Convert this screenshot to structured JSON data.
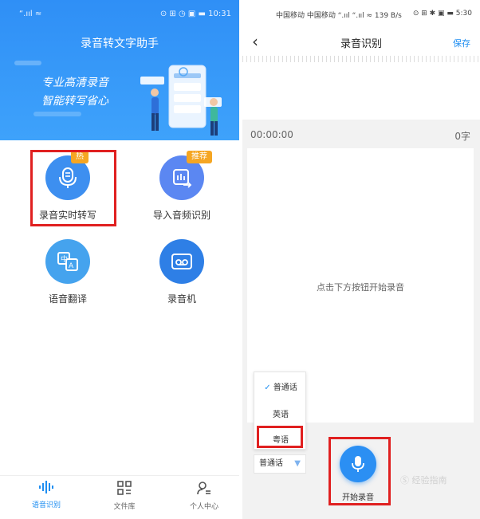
{
  "left": {
    "statusbar": {
      "signal": "“.ııl ≈",
      "right": "⊙ ⊞ ◷ ▣ ▬ 10:31"
    },
    "app_title": "录音转文字助手",
    "banner": {
      "line1": "专业高清录音",
      "line2": "智能转写省心"
    },
    "features": [
      {
        "label": "录音实时转写",
        "badge": "热",
        "icon": "mic-icon"
      },
      {
        "label": "导入音频识别",
        "badge": "推荐",
        "icon": "import-icon"
      },
      {
        "label": "语音翻译",
        "badge": "",
        "icon": "translate-icon"
      },
      {
        "label": "录音机",
        "badge": "",
        "icon": "recorder-icon"
      }
    ],
    "tabs": [
      {
        "label": "语音识别",
        "icon": "waveform-icon",
        "active": true
      },
      {
        "label": "文件库",
        "icon": "grid-icon",
        "active": false
      },
      {
        "label": "个人中心",
        "icon": "user-icon",
        "active": false
      }
    ],
    "colors": {
      "header": "#2f8ff6",
      "accent": "#1f8ef1",
      "badge": "#f5a623",
      "highlight": "#e02020"
    }
  },
  "right": {
    "statusbar": {
      "left": "中国移动 中国移动 “.ııl “.ııl ≈ 139 B/s",
      "right": "⊙ ⊞ ✱ ▣ ▬ 5:30"
    },
    "title": "录音识别",
    "save_label": "保存",
    "timer": "00:00:00",
    "char_count": "0字",
    "hint": "点击下方按钮开始录音",
    "languages": [
      "普通话",
      "英语",
      "粤语"
    ],
    "selected_language": "普通话",
    "record_label": "开始录音",
    "watermark": "Ⓢ 经验指南"
  }
}
